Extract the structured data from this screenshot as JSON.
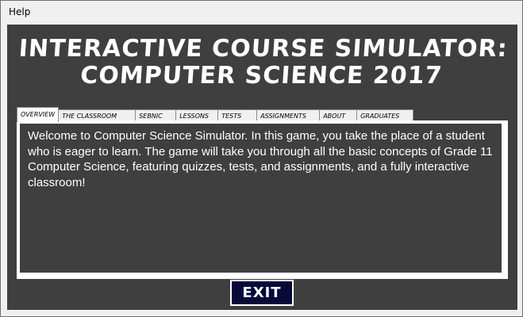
{
  "menu": {
    "items": [
      "Help"
    ]
  },
  "title": {
    "line1": "Interactive Course Simulator:",
    "line2": "Computer Science 2017"
  },
  "tabs": [
    {
      "label": "Overview",
      "active": true
    },
    {
      "label": "The Classroom",
      "active": false
    },
    {
      "label": "SEBNIC",
      "active": false
    },
    {
      "label": "Lessons",
      "active": false
    },
    {
      "label": "Tests",
      "active": false
    },
    {
      "label": "Assignments",
      "active": false
    },
    {
      "label": "About",
      "active": false
    },
    {
      "label": "Graduates",
      "active": false
    }
  ],
  "panel": {
    "text": "Welcome to Computer Science Simulator. In this game, you take the place of a student who is eager to learn. The game will take you through all the basic concepts of Grade 11 Computer Science, featuring quizzes, tests, and assignments, and a fully interactive classroom!"
  },
  "exit_button": {
    "label": "EXIT"
  },
  "colors": {
    "background": "#3f3f3f",
    "exit_bg": "#0a0a3a",
    "text": "#ffffff"
  }
}
